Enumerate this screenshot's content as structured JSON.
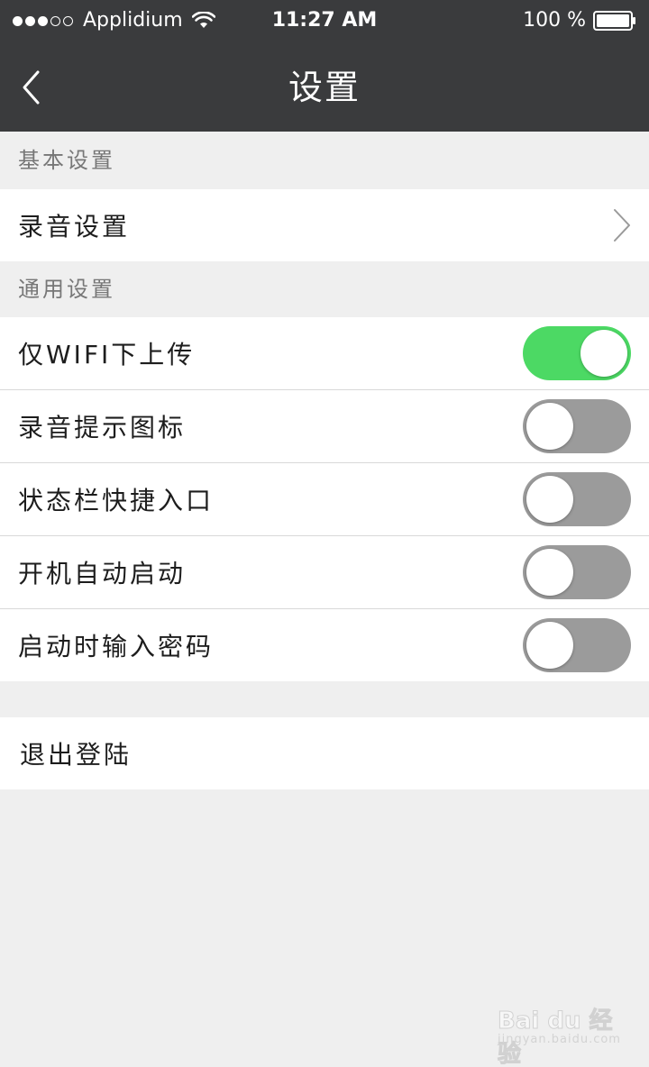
{
  "status_bar": {
    "carrier": "Applidium",
    "time": "11:27 AM",
    "battery_percent": "100 %",
    "signal_filled": 3,
    "signal_total": 5,
    "battery_level": 1.0
  },
  "nav": {
    "title": "设置",
    "back_icon": "chevron-left-icon"
  },
  "colors": {
    "header_bg": "#3a3b3d",
    "page_bg": "#efefef",
    "toggle_on": "#4cd964",
    "toggle_off": "#9b9b9b"
  },
  "sections": [
    {
      "header": "基本设置",
      "rows": [
        {
          "label": "录音设置",
          "type": "disclosure",
          "icon": "chevron-right-icon"
        }
      ]
    },
    {
      "header": "通用设置",
      "rows": [
        {
          "label": "仅WIFI下上传",
          "type": "toggle",
          "on": true
        },
        {
          "label": "录音提示图标",
          "type": "toggle",
          "on": false
        },
        {
          "label": "状态栏快捷入口",
          "type": "toggle",
          "on": false
        },
        {
          "label": "开机自动启动",
          "type": "toggle",
          "on": false
        },
        {
          "label": "启动时输入密码",
          "type": "toggle",
          "on": false
        }
      ]
    }
  ],
  "logout": {
    "label": "退出登陆"
  },
  "watermark": {
    "logo": "Bai du 经验",
    "sub": "jingyan.baidu.com"
  }
}
